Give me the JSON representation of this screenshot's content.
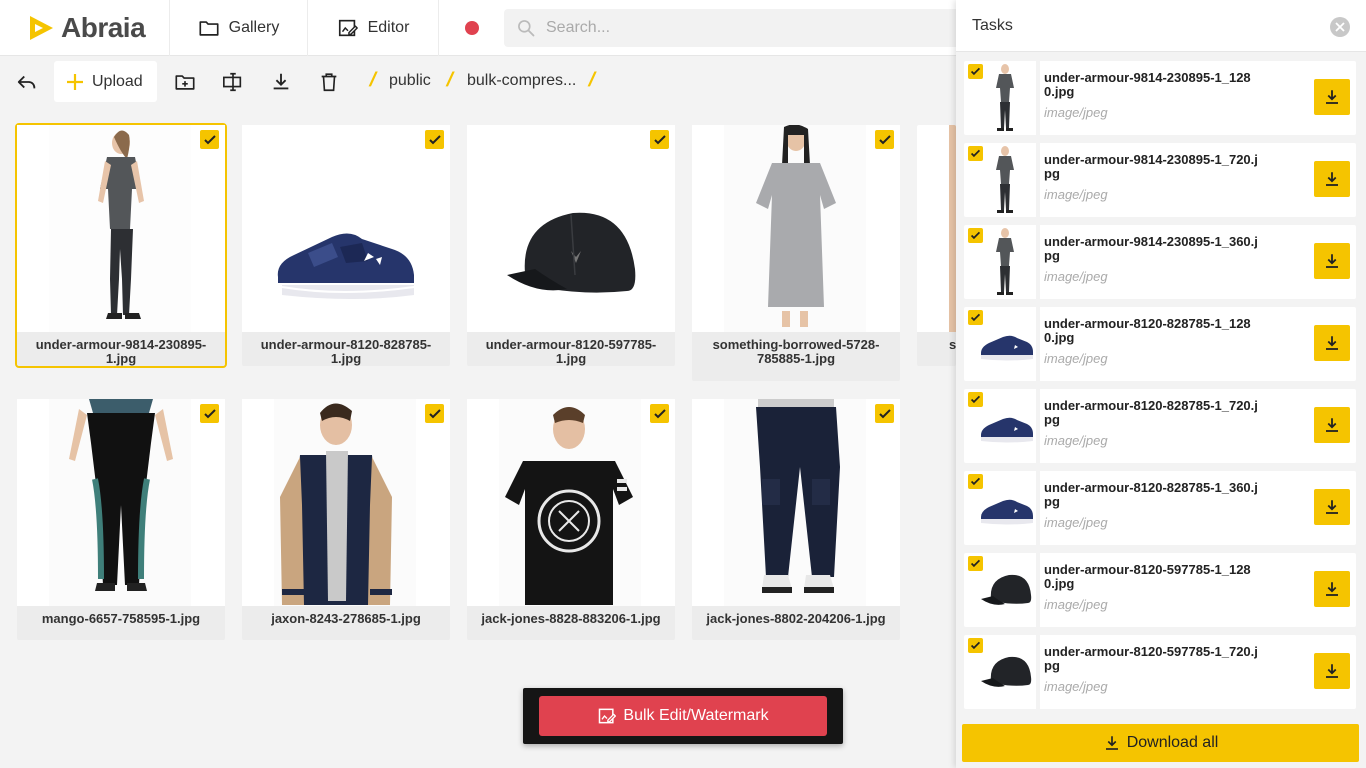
{
  "app": {
    "name": "Abraia",
    "accent": "#f5c400",
    "danger": "#e0424f"
  },
  "nav": {
    "gallery_label": "Gallery",
    "editor_label": "Editor"
  },
  "search": {
    "placeholder": "Search..."
  },
  "toolbar": {
    "upload_label": "Upload",
    "breadcrumb": [
      "public",
      "bulk-compres..."
    ]
  },
  "grid": {
    "items": [
      {
        "name": "under-armour-9814-230895-1.jpg",
        "selected": true,
        "checked": true,
        "image": "woman-grey-tee-leggings"
      },
      {
        "name": "under-armour-8120-828785-1.jpg",
        "checked": true,
        "image": "navy-sneaker"
      },
      {
        "name": "under-armour-8120-597785-1.jpg",
        "checked": true,
        "image": "black-cap"
      },
      {
        "name": "something-borrowed-5728-785885-1.jpg",
        "checked": true,
        "image": "grey-tshirt-dress"
      },
      {
        "name": "mango-6657-758595-1.jpg",
        "checked": true,
        "image": "floral-leggings"
      },
      {
        "name": "jaxon-8243-278685-1.jpg",
        "checked": true,
        "image": "varsity-jacket"
      },
      {
        "name": "jack-jones-8828-883206-1.jpg",
        "checked": true,
        "image": "black-graphic-tee"
      },
      {
        "name": "jack-jones-8802-204206-1.jpg",
        "checked": true,
        "image": "navy-cargo-pants"
      }
    ],
    "partial_caption": "s"
  },
  "tasks": {
    "title": "Tasks",
    "items": [
      {
        "name": "under-armour-9814-230895-1_1280.jpg",
        "type": "image/jpeg",
        "image": "woman-grey-tee-leggings"
      },
      {
        "name": "under-armour-9814-230895-1_720.jpg",
        "type": "image/jpeg",
        "image": "woman-grey-tee-leggings"
      },
      {
        "name": "under-armour-9814-230895-1_360.jpg",
        "type": "image/jpeg",
        "image": "woman-grey-tee-leggings"
      },
      {
        "name": "under-armour-8120-828785-1_1280.jpg",
        "type": "image/jpeg",
        "image": "navy-sneaker"
      },
      {
        "name": "under-armour-8120-828785-1_720.jpg",
        "type": "image/jpeg",
        "image": "navy-sneaker"
      },
      {
        "name": "under-armour-8120-828785-1_360.jpg",
        "type": "image/jpeg",
        "image": "navy-sneaker"
      },
      {
        "name": "under-armour-8120-597785-1_1280.jpg",
        "type": "image/jpeg",
        "image": "black-cap"
      },
      {
        "name": "under-armour-8120-597785-1_720.jpg",
        "type": "image/jpeg",
        "image": "black-cap"
      }
    ],
    "download_all_label": "Download all"
  },
  "bulk": {
    "label": "Bulk Edit/Watermark"
  }
}
